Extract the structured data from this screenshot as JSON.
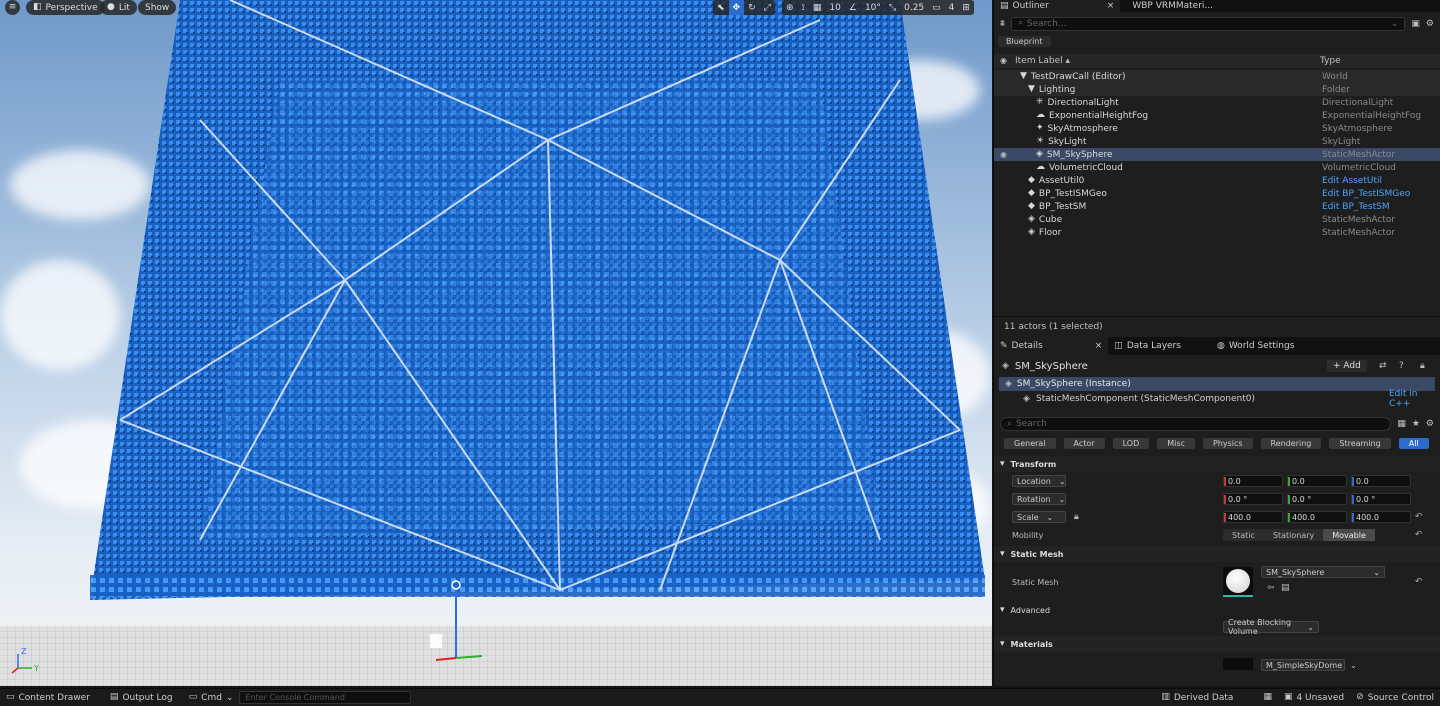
{
  "viewport": {
    "menu_icon": "hamburger-icon",
    "perspective": "Perspective",
    "lit": "Lit",
    "show": "Show",
    "grid_snap": "10",
    "rot_snap": "10°",
    "scale_snap": "0.25",
    "camera_speed": "4",
    "axis": {
      "z": "Z",
      "y": "Y"
    },
    "colors": {
      "cubes": "#1f6fd6",
      "sky_top": "#6f98c9",
      "ground": "#dedede"
    }
  },
  "outliner": {
    "tabs": [
      {
        "label": "Outliner"
      },
      {
        "label": "WBP VRMMateri..."
      }
    ],
    "search_placeholder": "Search...",
    "blueprint_filter": "Blueprint",
    "col_label": "Item Label ▴",
    "col_type": "Type",
    "rows": [
      {
        "label": "TestDrawCall (Editor)",
        "type": "World",
        "indent": 0,
        "icon": "▼",
        "link": false
      },
      {
        "label": "Lighting",
        "type": "Folder",
        "indent": 1,
        "icon": "▼",
        "link": false
      },
      {
        "label": "DirectionalLight",
        "type": "DirectionalLight",
        "indent": 2,
        "icon": "✳",
        "link": false
      },
      {
        "label": "ExponentialHeightFog",
        "type": "ExponentialHeightFog",
        "indent": 2,
        "icon": "☁",
        "link": false
      },
      {
        "label": "SkyAtmosphere",
        "type": "SkyAtmosphere",
        "indent": 2,
        "icon": "✦",
        "link": false
      },
      {
        "label": "SkyLight",
        "type": "SkyLight",
        "indent": 2,
        "icon": "☀",
        "link": false
      },
      {
        "label": "SM_SkySphere",
        "type": "StaticMeshActor",
        "indent": 2,
        "icon": "◈",
        "link": false
      },
      {
        "label": "VolumetricCloud",
        "type": "VolumetricCloud",
        "indent": 2,
        "icon": "☁",
        "link": false
      },
      {
        "label": "AssetUtil0",
        "type": "Edit AssetUtil",
        "indent": 1,
        "icon": "◆",
        "link": true
      },
      {
        "label": "BP_TestISMGeo",
        "type": "Edit BP_TestISMGeo",
        "indent": 1,
        "icon": "◆",
        "link": true
      },
      {
        "label": "BP_TestSM",
        "type": "Edit BP_TestSM",
        "indent": 1,
        "icon": "◆",
        "link": true
      },
      {
        "label": "Cube",
        "type": "StaticMeshActor",
        "indent": 1,
        "icon": "◈",
        "link": false
      },
      {
        "label": "Floor",
        "type": "StaticMeshActor",
        "indent": 1,
        "icon": "◈",
        "link": false
      }
    ],
    "status": "11 actors (1 selected)"
  },
  "details": {
    "tabs": [
      {
        "label": "Details"
      },
      {
        "label": "Data Layers"
      },
      {
        "label": "World Settings"
      }
    ],
    "actor_name": "SM_SkySphere",
    "add_label": "+ Add",
    "instance_label": "SM_SkySphere (Instance)",
    "component_label": "StaticMeshComponent (StaticMeshComponent0)",
    "edit_cpp": "Edit in C++",
    "search_placeholder": "Search",
    "categories": [
      "General",
      "Actor",
      "LOD",
      "Misc",
      "Physics",
      "Rendering",
      "Streaming",
      "All"
    ],
    "active_category": "All",
    "transform_header": "Transform",
    "location_label": "Location",
    "rotation_label": "Rotation",
    "scale_label": "Scale",
    "location": [
      "0.0",
      "0.0",
      "0.0"
    ],
    "rotation": [
      "0.0 °",
      "0.0 °",
      "0.0 °"
    ],
    "scale": [
      "400.0",
      "400.0",
      "400.0"
    ],
    "mobility_label": "Mobility",
    "mobility_options": [
      "Static",
      "Stationary",
      "Movable"
    ],
    "mobility_selected": "Movable",
    "static_mesh_header": "Static Mesh",
    "static_mesh_label": "Static Mesh",
    "static_mesh_value": "SM_SkySphere",
    "advanced_header": "Advanced",
    "blocking_volume": "Create Blocking Volume",
    "materials_header": "Materials",
    "material_value": "M_SimpleSkyDome"
  },
  "bottom": {
    "content_drawer": "Content Drawer",
    "output_log": "Output Log",
    "cmd": "Cmd",
    "console_placeholder": "Enter Console Command",
    "derived_data": "Derived Data",
    "unsaved": "4 Unsaved",
    "source_control": "Source Control"
  }
}
